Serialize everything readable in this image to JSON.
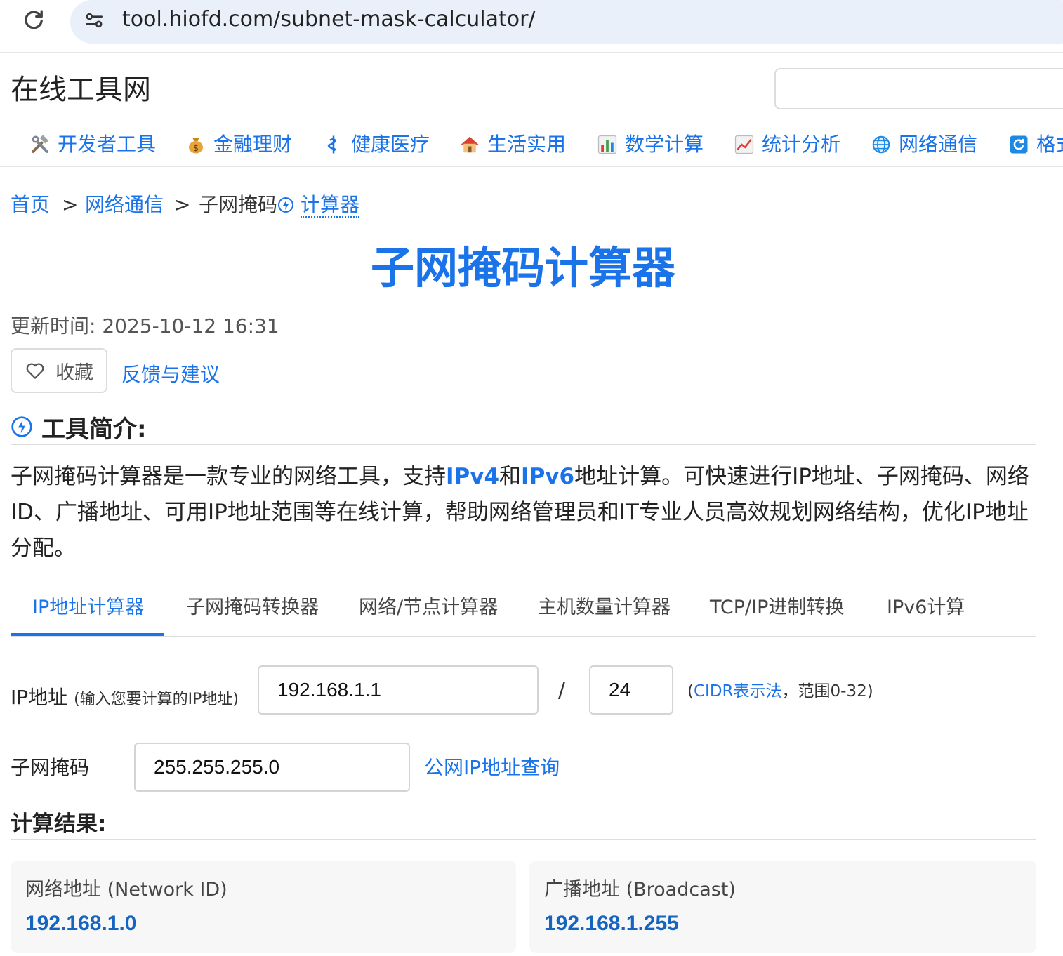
{
  "browser": {
    "url": "tool.hiofd.com/subnet-mask-calculator/"
  },
  "site": {
    "logo": "在线工具网",
    "search_placeholder": ""
  },
  "nav": [
    {
      "icon": "hammer-wrench-icon",
      "label": "开发者工具"
    },
    {
      "icon": "money-bag-icon",
      "label": "金融理财"
    },
    {
      "icon": "medical-icon",
      "label": "健康医疗"
    },
    {
      "icon": "house-icon",
      "label": "生活实用"
    },
    {
      "icon": "bar-chart-icon",
      "label": "数学计算"
    },
    {
      "icon": "trend-chart-icon",
      "label": "统计分析"
    },
    {
      "icon": "globe-icon",
      "label": "网络通信"
    },
    {
      "icon": "refresh-icon",
      "label": "格式"
    }
  ],
  "breadcrumb": {
    "home": "首页",
    "sep": ">",
    "category": "网络通信",
    "current_a": "子网掩码",
    "current_b": "计算器"
  },
  "page": {
    "title": "子网掩码计算器",
    "updated": "更新时间: 2025-10-12 16:31",
    "favorite_label": "收藏",
    "feedback_label": "反馈与建议",
    "intro_title": "工具简介:",
    "desc_1": "子网掩码计算器是一款专业的网络工具，支持",
    "desc_ipv4": "IPv4",
    "desc_and": "和",
    "desc_ipv6": "IPv6",
    "desc_2": "地址计算。可快速进行IP地址、子网掩码、网络ID、广播地址、可用IP地址范围等在线计算，帮助网络管理员和IT专业人员高效规划网络结构，优化IP地址分配。"
  },
  "tabs": [
    "IP地址计算器",
    "子网掩码转换器",
    "网络/节点计算器",
    "主机数量计算器",
    "TCP/IP进制转换",
    "IPv6计算"
  ],
  "form": {
    "ip_label": "IP地址",
    "ip_hint": "(输入您要计算的IP地址)",
    "ip_value": "192.168.1.1",
    "slash": "/",
    "cidr_value": "24",
    "cidr_open": "(",
    "cidr_link": "CIDR表示法",
    "cidr_range": "，范围0-32)",
    "mask_label": "子网掩码",
    "mask_value": "255.255.255.0",
    "public_ip_link": "公网IP地址查询"
  },
  "results": {
    "heading": "计算结果:",
    "network_label": "网络地址 (Network ID)",
    "network_value": "192.168.1.0",
    "broadcast_label": "广播地址 (Broadcast)",
    "broadcast_value": "192.168.1.255"
  },
  "colors": {
    "accent": "#1a73e8",
    "result_value": "#1565c0",
    "address_bar": "#eaf0fa"
  }
}
